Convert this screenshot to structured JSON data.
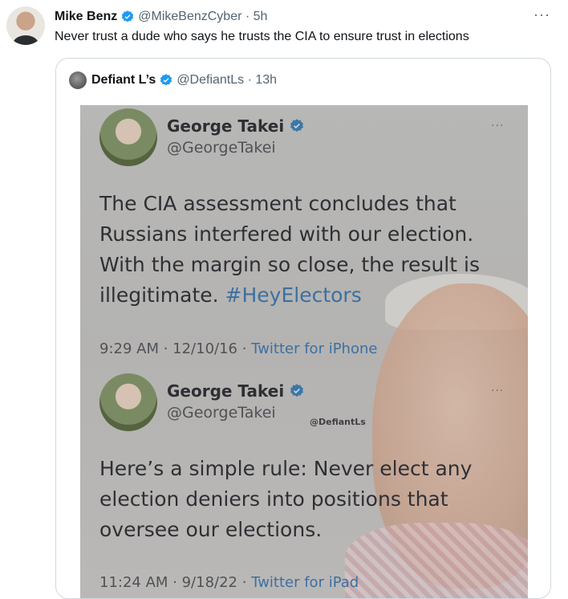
{
  "tweet": {
    "author_name": "Mike Benz",
    "handle": "@MikeBenzCyber",
    "time": "5h",
    "more": "···",
    "text": "Never trust a dude who says he trusts the CIA to ensure trust in elections"
  },
  "quoted": {
    "author_name": "Defiant L’s",
    "handle": "@DefiantLs",
    "time": "13h",
    "screenshot": {
      "watermark": "@DefiantLs",
      "tweets": [
        {
          "name": "George Takei",
          "handle": "@GeorgeTakei",
          "more": "···",
          "body": "The CIA assessment concludes that Russians interfered with our election. With the margin so close, the result is illegitimate.",
          "hashtag": "#HeyElectors",
          "timestamp": "9:29 AM · 12/10/16 · ",
          "source": "Twitter for iPhone"
        },
        {
          "name": "George Takei",
          "handle": "@GeorgeTakei",
          "more": "···",
          "body": "Here’s a simple rule: Never elect any election deniers into positions that oversee our elections.",
          "timestamp": "11:24 AM · 9/18/22 · ",
          "source": "Twitter for iPad"
        }
      ]
    }
  },
  "colors": {
    "verified": "#1d9bf0",
    "muted": "#536471",
    "border": "#cfd9de",
    "link": "#3d6fa2"
  },
  "icons": {
    "verified": "verified-badge-icon",
    "more": "more-dots-icon"
  }
}
